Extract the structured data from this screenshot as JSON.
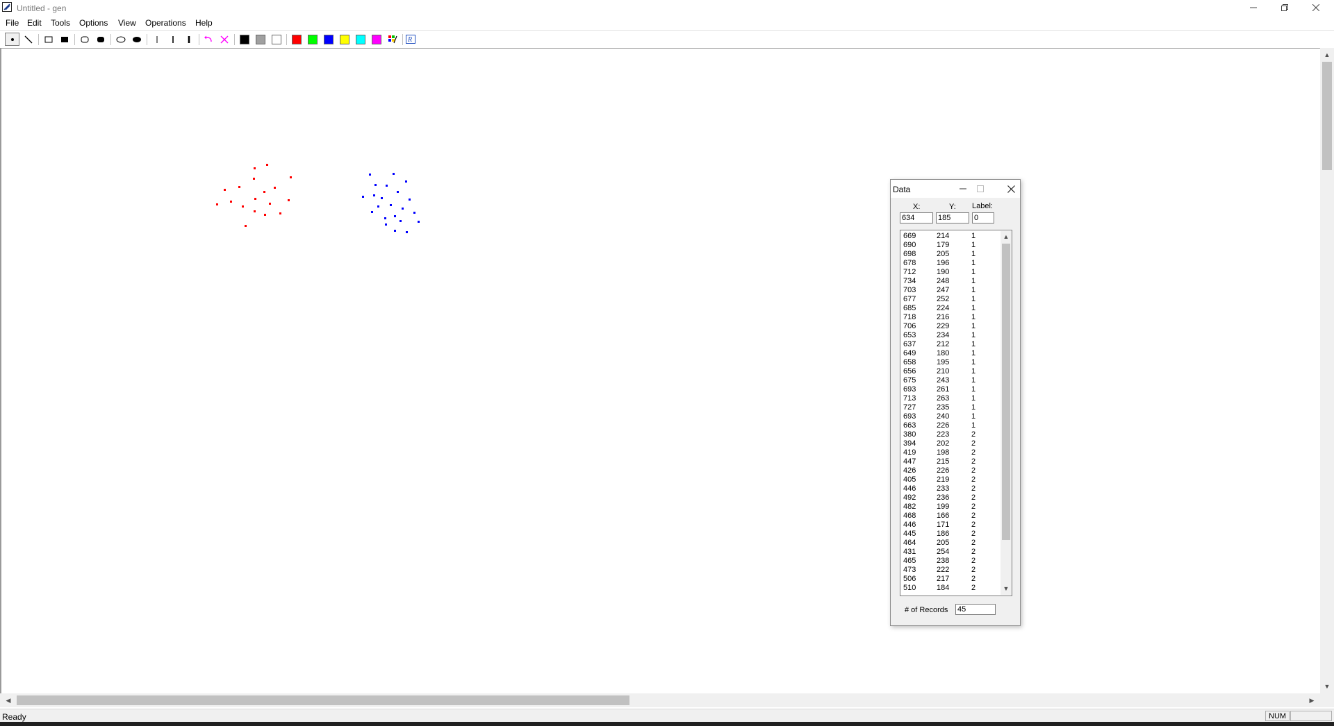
{
  "window": {
    "title": "Untitled - gen"
  },
  "window_controls": [
    "minimize",
    "restore",
    "close"
  ],
  "menu": [
    "File",
    "Edit",
    "Tools",
    "Options",
    "View",
    "Operations",
    "Help"
  ],
  "toolbar": {
    "tools": [
      "point-tool",
      "line-tool",
      "rect-outline-tool",
      "rect-filled-tool",
      "roundrect-outline-tool",
      "roundrect-filled-tool",
      "ellipse-outline-tool",
      "ellipse-filled-tool",
      "thin-line-width",
      "medium-line-width",
      "thick-line-width",
      "undo",
      "clear"
    ],
    "colors": [
      "#000000",
      "#a0a0a0",
      "#ffffff",
      "#ff0000",
      "#00ff00",
      "#0000ff",
      "#ffff00",
      "#00ffff",
      "#ff00ff"
    ],
    "custom_color": "custom-color-picker",
    "script_tool": "font-tool"
  },
  "plot": {
    "colors": {
      "1": "#0000ff",
      "2": "#ff0000"
    }
  },
  "data_dialog": {
    "title": "Data",
    "x_label": "X:",
    "y_label": "Y:",
    "label_label": "Label:",
    "x_value": "634",
    "y_value": "185",
    "label_value": "0",
    "records_label": "# of Records",
    "records_value": "45",
    "rows": [
      [
        "669",
        "214",
        "1"
      ],
      [
        "690",
        "179",
        "1"
      ],
      [
        "698",
        "205",
        "1"
      ],
      [
        "678",
        "196",
        "1"
      ],
      [
        "712",
        "190",
        "1"
      ],
      [
        "734",
        "248",
        "1"
      ],
      [
        "703",
        "247",
        "1"
      ],
      [
        "677",
        "252",
        "1"
      ],
      [
        "685",
        "224",
        "1"
      ],
      [
        "718",
        "216",
        "1"
      ],
      [
        "706",
        "229",
        "1"
      ],
      [
        "653",
        "234",
        "1"
      ],
      [
        "637",
        "212",
        "1"
      ],
      [
        "649",
        "180",
        "1"
      ],
      [
        "658",
        "195",
        "1"
      ],
      [
        "656",
        "210",
        "1"
      ],
      [
        "675",
        "243",
        "1"
      ],
      [
        "693",
        "261",
        "1"
      ],
      [
        "713",
        "263",
        "1"
      ],
      [
        "727",
        "235",
        "1"
      ],
      [
        "693",
        "240",
        "1"
      ],
      [
        "663",
        "226",
        "1"
      ],
      [
        "380",
        "223",
        "2"
      ],
      [
        "394",
        "202",
        "2"
      ],
      [
        "419",
        "198",
        "2"
      ],
      [
        "447",
        "215",
        "2"
      ],
      [
        "426",
        "226",
        "2"
      ],
      [
        "405",
        "219",
        "2"
      ],
      [
        "446",
        "233",
        "2"
      ],
      [
        "492",
        "236",
        "2"
      ],
      [
        "482",
        "199",
        "2"
      ],
      [
        "468",
        "166",
        "2"
      ],
      [
        "446",
        "171",
        "2"
      ],
      [
        "445",
        "186",
        "2"
      ],
      [
        "464",
        "205",
        "2"
      ],
      [
        "431",
        "254",
        "2"
      ],
      [
        "465",
        "238",
        "2"
      ],
      [
        "473",
        "222",
        "2"
      ],
      [
        "506",
        "217",
        "2"
      ],
      [
        "510",
        "184",
        "2"
      ]
    ]
  },
  "status": {
    "text": "Ready",
    "num": "NUM"
  }
}
